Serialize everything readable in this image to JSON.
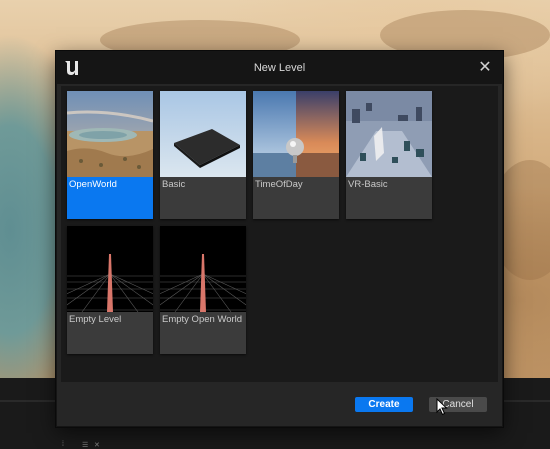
{
  "dialog": {
    "title": "New Level",
    "logo_icon": "unreal-engine-logo-icon",
    "close_icon": "close-icon",
    "close_glyph": "✕"
  },
  "templates": [
    {
      "label": "OpenWorld",
      "selected": true
    },
    {
      "label": "Basic",
      "selected": false
    },
    {
      "label": "TimeOfDay",
      "selected": false
    },
    {
      "label": "VR-Basic",
      "selected": false
    },
    {
      "label": "Empty Level",
      "selected": false
    },
    {
      "label": "Empty Open World",
      "selected": false
    }
  ],
  "buttons": {
    "create_label": "Create",
    "cancel_label": "Cancel"
  },
  "colors": {
    "accent": "#0a78f0",
    "dialog_bg": "#262626",
    "titlebar_bg": "#151515"
  }
}
